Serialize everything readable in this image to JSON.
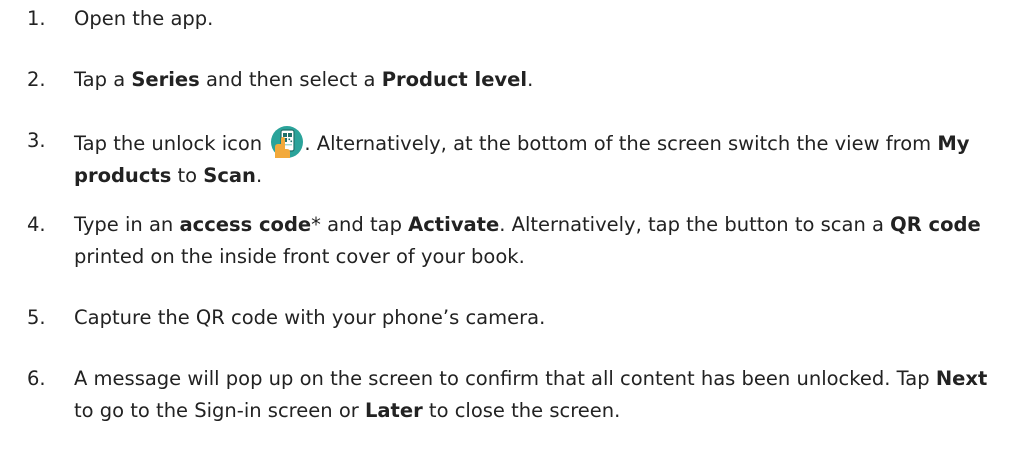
{
  "steps": [
    {
      "number": "1.",
      "segments": [
        {
          "text": "Open the app.",
          "bold": false
        }
      ]
    },
    {
      "number": "2.",
      "segments": [
        {
          "text": "Tap a ",
          "bold": false
        },
        {
          "text": "Series",
          "bold": true
        },
        {
          "text": " and then select a ",
          "bold": false
        },
        {
          "text": "Product level",
          "bold": true
        },
        {
          "text": ".",
          "bold": false
        }
      ]
    },
    {
      "number": "3.",
      "segments": [
        {
          "text": "Tap the unlock icon ",
          "bold": false
        },
        {
          "icon": "unlock-icon"
        },
        {
          "text": ". Alternatively, at the bottom of the screen switch the view from ",
          "bold": false
        },
        {
          "text": "My products",
          "bold": true
        },
        {
          "text": " to ",
          "bold": false
        },
        {
          "text": "Scan",
          "bold": true
        },
        {
          "text": ".",
          "bold": false
        }
      ]
    },
    {
      "number": "4.",
      "segments": [
        {
          "text": "Type in an ",
          "bold": false
        },
        {
          "text": "access code",
          "bold": true
        },
        {
          "text": "* and tap ",
          "bold": false
        },
        {
          "text": "Activate",
          "bold": true
        },
        {
          "text": ". Alternatively, tap the button to scan a ",
          "bold": false
        },
        {
          "text": "QR code",
          "bold": true
        },
        {
          "text": " printed on the inside front cover of your book.",
          "bold": false
        }
      ]
    },
    {
      "number": "5.",
      "segments": [
        {
          "text": "Capture the QR code with your phone’s camera.",
          "bold": false
        }
      ]
    },
    {
      "number": "6.",
      "segments": [
        {
          "text": "A message will pop up on the screen to confirm that all content has been unlocked. Tap ",
          "bold": false
        },
        {
          "text": "Next",
          "bold": true
        },
        {
          "text": " to go to the Sign-in screen or ",
          "bold": false
        },
        {
          "text": "Later",
          "bold": true
        },
        {
          "text": " to close the screen.",
          "bold": false
        }
      ]
    }
  ],
  "colors": {
    "text": "#222222",
    "icon_circle": "#2aa39a",
    "icon_hand": "#f2a93b"
  }
}
